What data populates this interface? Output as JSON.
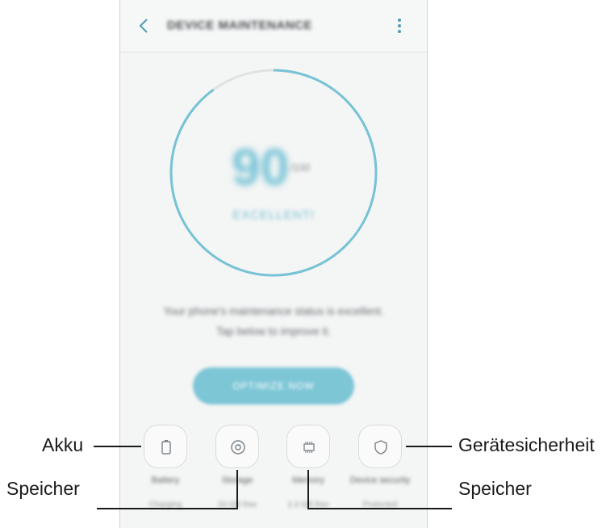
{
  "appbar": {
    "title": "DEVICE MAINTENANCE",
    "back_icon": "chevron-left-icon",
    "more_icon": "more-vertical-icon"
  },
  "gauge": {
    "score": "90",
    "unit": "/100",
    "rating": "EXCELLENT!",
    "progress": 0.9,
    "accent_color": "#76c3d6",
    "track_color": "#dfe2e3"
  },
  "status": {
    "line1": "Your phone's maintenance status is excellent.",
    "line2": "Tap below to improve it."
  },
  "optimize_button": {
    "label": "OPTIMIZE NOW",
    "color": "#7dc6d6"
  },
  "tiles": [
    {
      "label": "Battery",
      "value": "Charging",
      "icon": "battery-icon"
    },
    {
      "label": "Storage",
      "value": "24 GB free",
      "icon": "storage-disc-icon"
    },
    {
      "label": "Memory",
      "value": "2.4 GB free",
      "icon": "memory-chip-icon"
    },
    {
      "label": "Device security",
      "value": "Protected",
      "icon": "shield-icon"
    }
  ],
  "callouts": {
    "battery": "Akku",
    "storage": "Speicher",
    "memory": "Speicher",
    "security": "Gerätesicherheit"
  }
}
